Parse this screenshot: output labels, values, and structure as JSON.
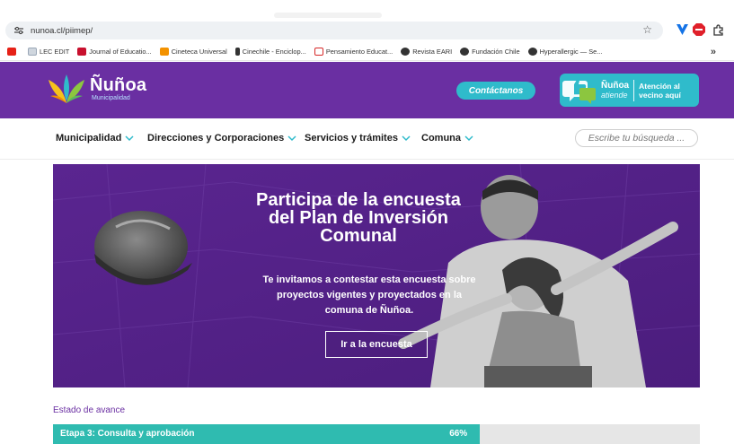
{
  "browser": {
    "url": "nunoa.cl/piimep/",
    "bookmarks": [
      {
        "label": "",
        "icon": "youtube-icon",
        "color": "#e62117"
      },
      {
        "label": "LEC EDIT",
        "icon": "lec-edit-icon",
        "color": "#9aa7b7"
      },
      {
        "label": "Journal of Educatio...",
        "icon": "journal-icon",
        "color": "#c8102e"
      },
      {
        "label": "Cineteca Universal",
        "icon": "cineteca-icon",
        "color": "#f39200"
      },
      {
        "label": "Cinechile - Enciclop...",
        "icon": "cinechile-icon",
        "color": "#333333"
      },
      {
        "label": "Pensamiento Educat...",
        "icon": "pensamiento-icon",
        "color": "#d62828"
      },
      {
        "label": "Revista EARI",
        "icon": "globe-icon",
        "color": "#333333"
      },
      {
        "label": "Fundación Chile",
        "icon": "globe-icon",
        "color": "#333333"
      },
      {
        "label": "Hyperallergic — Se...",
        "icon": "globe-icon",
        "color": "#333333"
      }
    ],
    "more": "»"
  },
  "header": {
    "logo_name": "Ñuñoa",
    "logo_sub": "Municipalidad",
    "contact_label": "Contáctanos",
    "atiende_brand": "Ñuñoa",
    "atiende_brand_sub": "atiende",
    "atiende_line1": "Atención al",
    "atiende_line2": "vecino aquí",
    "purple": "#6a2fa2",
    "teal": "#2fbbcb"
  },
  "nav": {
    "items": [
      {
        "label": "Municipalidad"
      },
      {
        "label": "Direcciones y Corporaciones"
      },
      {
        "label": "Servicios y trámites"
      },
      {
        "label": "Comuna"
      }
    ],
    "search_placeholder": "Escribe tu búsqueda ..."
  },
  "hero": {
    "title_lines": [
      "Participa de la encuesta",
      "del Plan de Inversión",
      "Comunal"
    ],
    "body_lines": [
      "Te invitamos a contestar esta encuesta sobre",
      "proyectos vigentes y proyectados en la",
      "comuna de Ñuñoa."
    ],
    "cta": "Ir a la encuesta"
  },
  "progress": {
    "label": "Estado de avance",
    "stage": "Etapa 3: Consulta y aprobación",
    "percent_text": "66%",
    "percent": 66
  }
}
